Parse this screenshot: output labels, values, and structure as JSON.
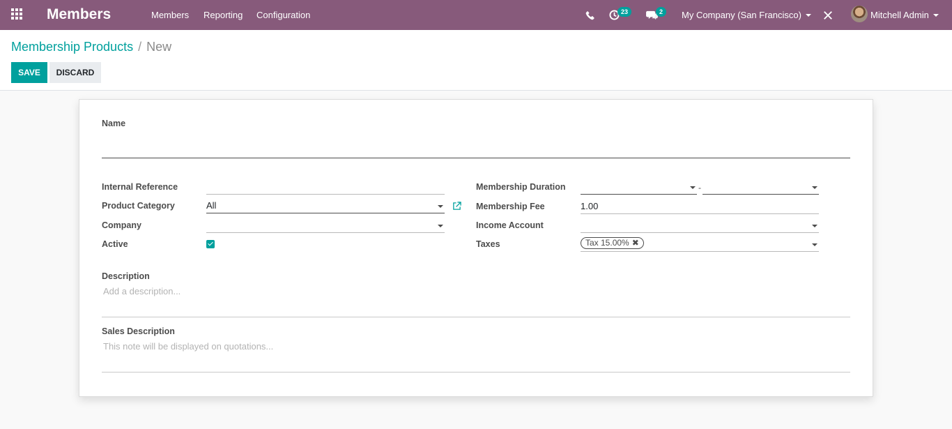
{
  "navbar": {
    "app_name": "Members",
    "menu": [
      "Members",
      "Reporting",
      "Configuration"
    ],
    "activity_count": "23",
    "message_count": "2",
    "company": "My Company (San Francisco)",
    "user": "Mitchell Admin"
  },
  "breadcrumb": {
    "parent": "Membership Products",
    "separator": "/",
    "current": "New"
  },
  "buttons": {
    "save": "SAVE",
    "discard": "DISCARD"
  },
  "form": {
    "name_label": "Name",
    "internal_reference_label": "Internal Reference",
    "product_category_label": "Product Category",
    "product_category_value": "All",
    "company_label": "Company",
    "active_label": "Active",
    "active_checked": true,
    "membership_duration_label": "Membership Duration",
    "duration_separator": "-",
    "membership_fee_label": "Membership Fee",
    "membership_fee_value": "1.00",
    "income_account_label": "Income Account",
    "taxes_label": "Taxes",
    "tax_tag": "Tax 15.00%",
    "description_label": "Description",
    "description_placeholder": "Add a description...",
    "sales_description_label": "Sales Description",
    "sales_description_placeholder": "This note will be displayed on quotations..."
  },
  "colors": {
    "navbar": "#875a7b",
    "accent": "#00a09d"
  }
}
